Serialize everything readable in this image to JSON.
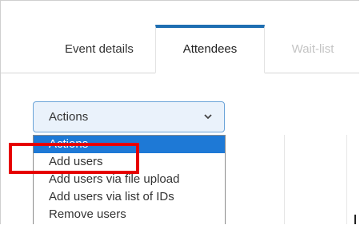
{
  "tabs": [
    {
      "label": "Event details",
      "state": "inactive"
    },
    {
      "label": "Attendees",
      "state": "active"
    },
    {
      "label": "Wait-list",
      "state": "disabled"
    }
  ],
  "actions_select": {
    "value": "Actions",
    "icon": "chevron-down-icon"
  },
  "dropdown_options": [
    {
      "label": "Actions",
      "selected": true
    },
    {
      "label": "Add users",
      "selected": false
    },
    {
      "label": "Add users via file upload",
      "selected": false
    },
    {
      "label": "Add users via list of IDs",
      "selected": false
    },
    {
      "label": "Remove users",
      "selected": false
    }
  ],
  "colors": {
    "active_tab_border": "#1f6fb2",
    "selected_option_bg": "#1e79d6",
    "highlight_annotation": "#e60000"
  }
}
